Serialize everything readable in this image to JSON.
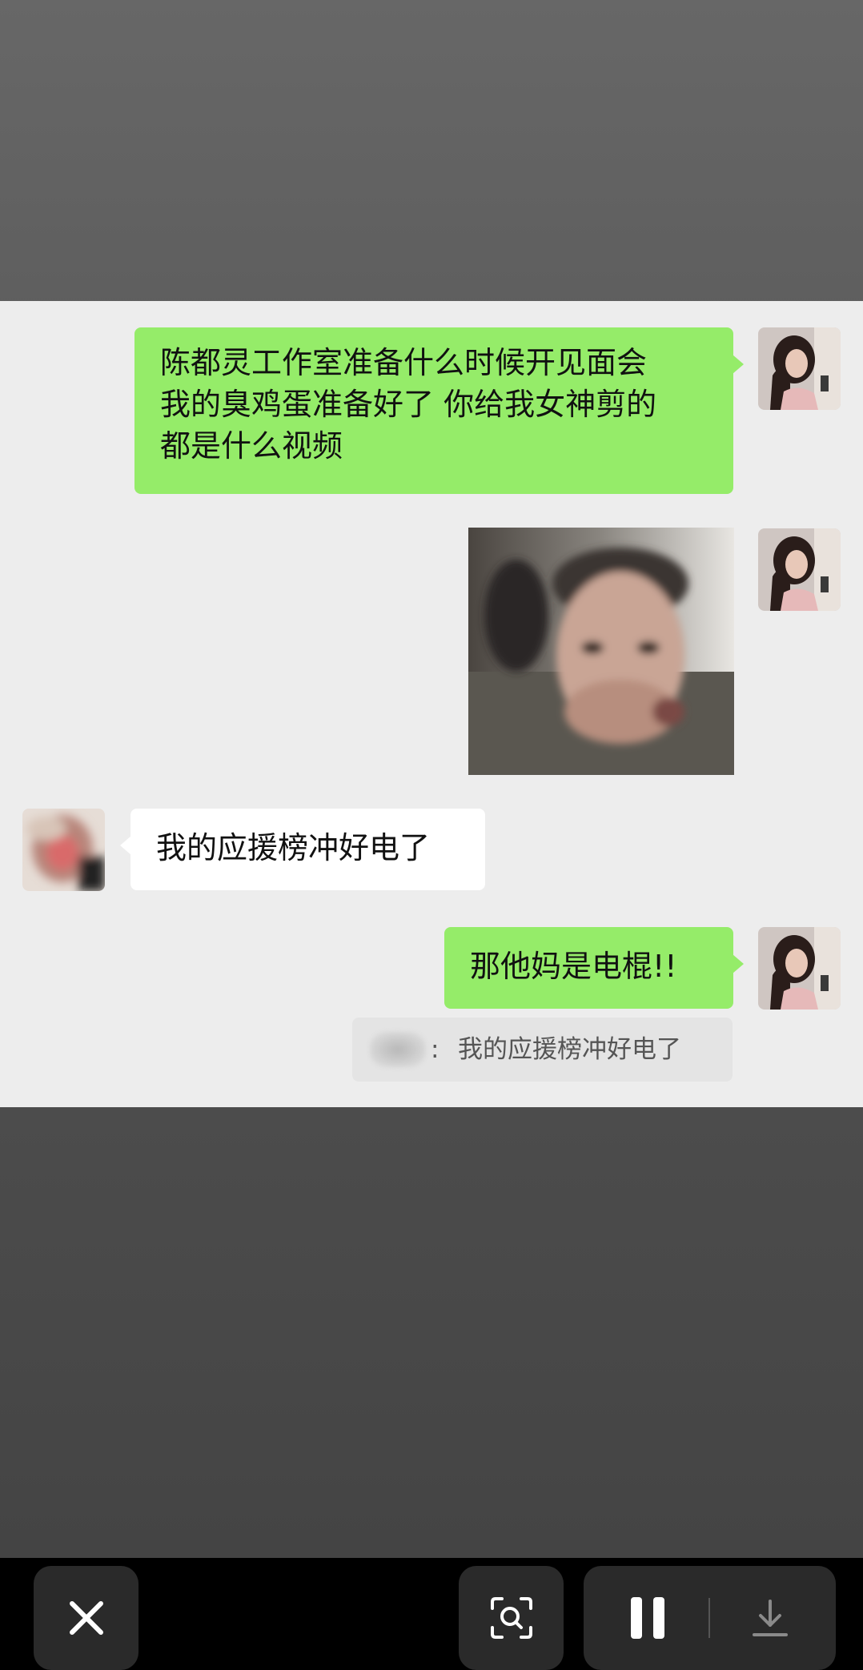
{
  "chat": {
    "messages": [
      {
        "side": "right",
        "type": "text",
        "lines": [
          "陈都灵工作室准备什么时候开见面会",
          "我的臭鸡蛋准备好了 你给我女神剪的",
          "都是什么视频"
        ]
      },
      {
        "side": "right",
        "type": "image",
        "description": "photo"
      },
      {
        "side": "left",
        "type": "text",
        "text": "我的应援榜冲好电了"
      },
      {
        "side": "right",
        "type": "text",
        "text": "那他妈是电棍!!"
      }
    ],
    "quote": {
      "colon": ":",
      "text": "我的应援榜冲好电了"
    }
  },
  "toolbar": {
    "close_icon": "close-icon",
    "scan_icon": "scan-search-icon",
    "pause_icon": "pause-icon",
    "download_icon": "download-icon"
  },
  "colors": {
    "green_bubble": "#95ec69",
    "white_bubble": "#ffffff",
    "chat_background": "#ededed",
    "toolbar_background": "#000000"
  }
}
